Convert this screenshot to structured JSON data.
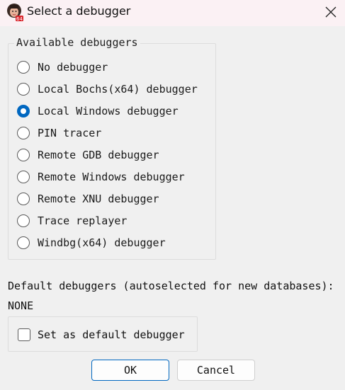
{
  "window": {
    "title": "Select a debugger"
  },
  "group": {
    "title": "Available debuggers",
    "options": [
      {
        "label": "No debugger",
        "checked": false
      },
      {
        "label": "Local Bochs(x64) debugger",
        "checked": false
      },
      {
        "label": "Local Windows debugger",
        "checked": true
      },
      {
        "label": "PIN tracer",
        "checked": false
      },
      {
        "label": "Remote GDB debugger",
        "checked": false
      },
      {
        "label": "Remote Windows debugger",
        "checked": false
      },
      {
        "label": "Remote XNU debugger",
        "checked": false
      },
      {
        "label": "Trace replayer",
        "checked": false
      },
      {
        "label": "Windbg(x64) debugger",
        "checked": false
      }
    ]
  },
  "defaults": {
    "label": "Default debuggers (autoselected for new databases):",
    "value": "NONE"
  },
  "checkbox": {
    "label": "Set as default debugger",
    "checked": false
  },
  "buttons": {
    "ok": "OK",
    "cancel": "Cancel"
  },
  "colors": {
    "accent": "#0067c0",
    "titlebar": "#fbf1f4",
    "background": "#f0f0f0"
  },
  "icons": {
    "app": "ida-app-icon",
    "close": "close-icon"
  }
}
